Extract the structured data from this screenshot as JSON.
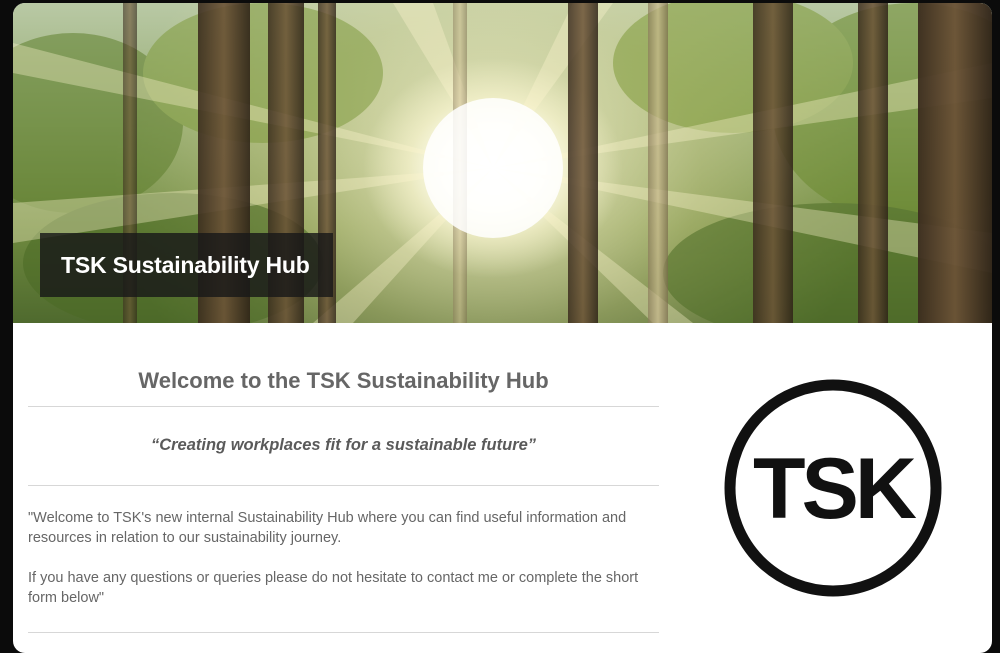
{
  "hero": {
    "title": "TSK Sustainability Hub"
  },
  "main": {
    "welcome_title": "Welcome to the TSK Sustainability Hub",
    "tagline": "“Creating workplaces fit for a sustainable future”",
    "paragraph_1": "\"Welcome to TSK's new internal Sustainability Hub where you can find useful information and resources in relation to our sustainability journey.",
    "paragraph_2": "If you have any questions or queries please do not hesitate to contact me or complete the short form below\""
  },
  "logo": {
    "text": "TSK",
    "color": "#111111"
  }
}
